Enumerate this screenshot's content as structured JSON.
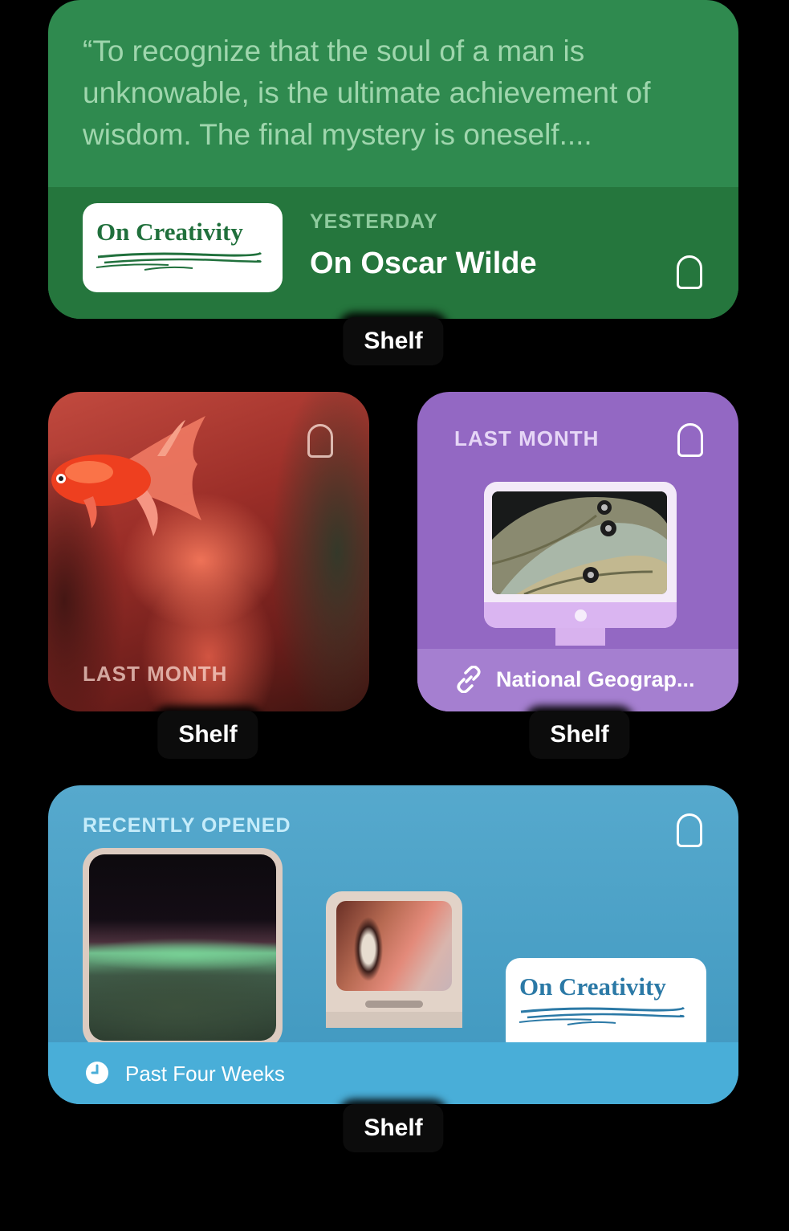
{
  "quote_widget": {
    "quote": "“To recognize that the soul of a man is unknowable, is the ultimate achievement of wisdom. The final mystery is oneself....",
    "logo_text": "On Creativity",
    "time_label": "YESTERDAY",
    "title": "On Oscar Wilde",
    "shelf_label": "Shelf"
  },
  "photo_widget": {
    "time_label": "LAST MONTH",
    "shelf_label": "Shelf"
  },
  "link_widget": {
    "time_label": "LAST MONTH",
    "link_text": "National Geograp...",
    "shelf_label": "Shelf"
  },
  "recent_widget": {
    "heading": "RECENTLY OPENED",
    "logo_text": "On Creativity",
    "footer_text": "Past Four Weeks",
    "shelf_label": "Shelf"
  },
  "colors": {
    "quote_bg": "#2f8a4f",
    "link_bg": "#9368c3",
    "recent_bg": "#4aa2c8"
  },
  "icons": [
    "bookmark-icon",
    "link-icon",
    "clock-icon"
  ]
}
